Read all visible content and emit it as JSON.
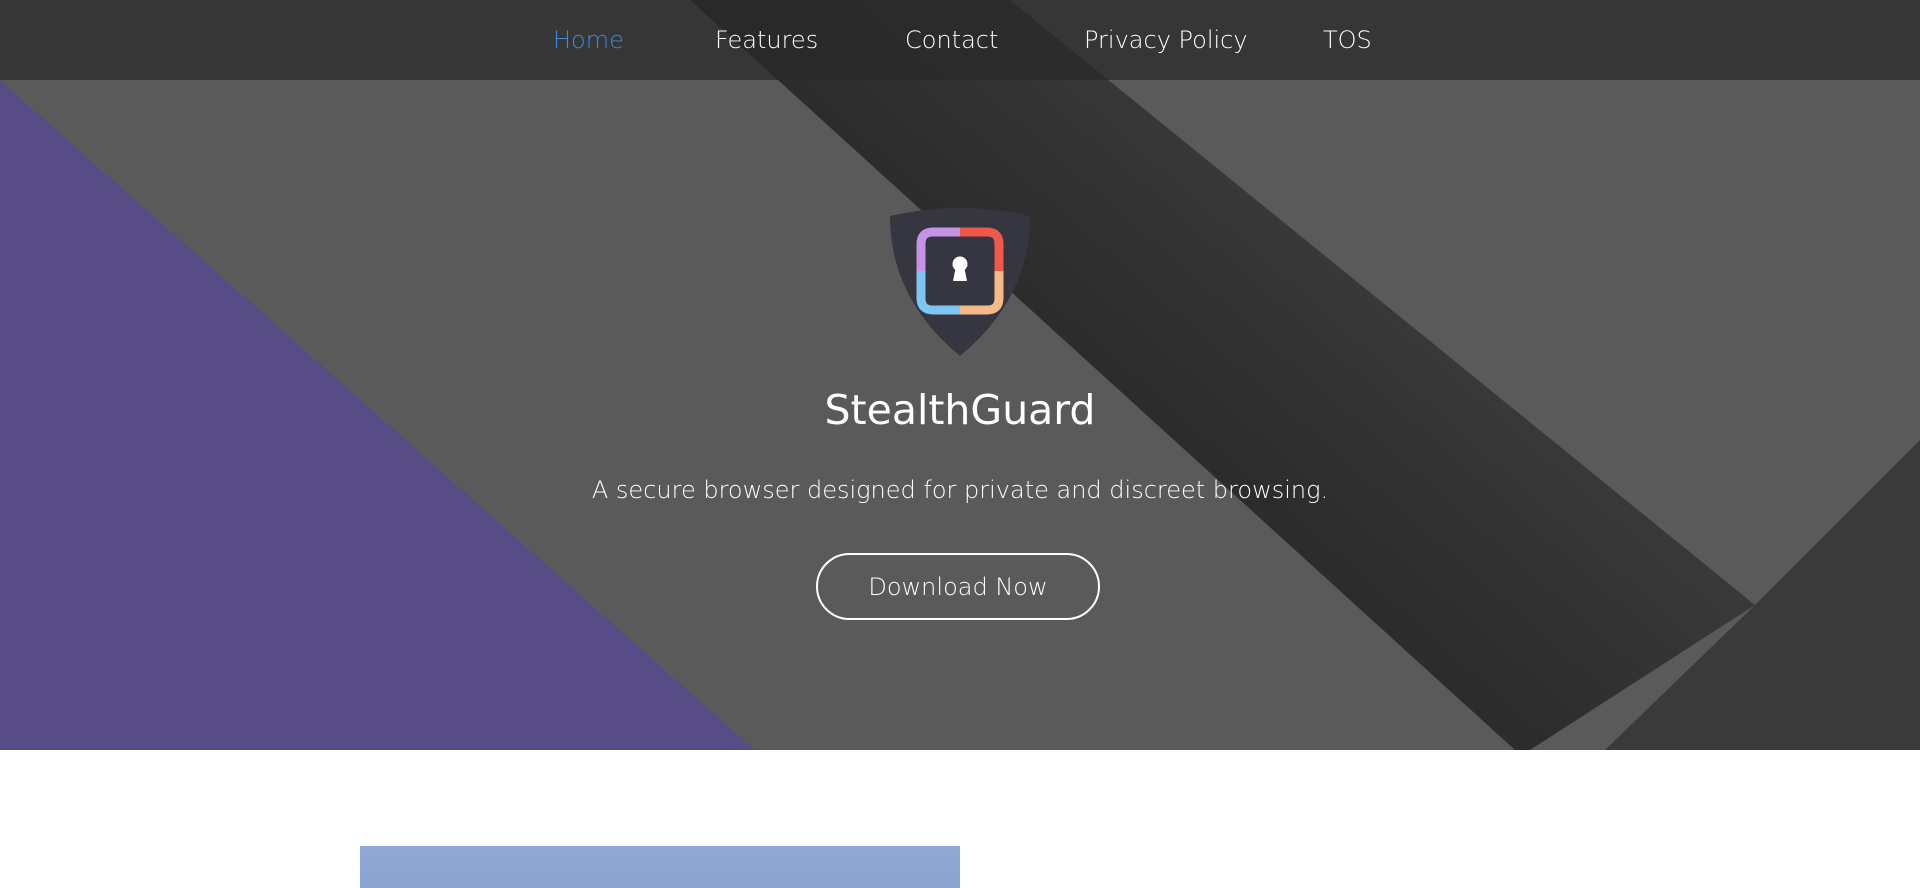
{
  "nav": {
    "items": [
      {
        "label": "Home",
        "active": true
      },
      {
        "label": "Features",
        "active": false
      },
      {
        "label": "Contact",
        "active": false
      },
      {
        "label": "Privacy Policy",
        "active": false
      },
      {
        "label": "TOS",
        "active": false
      }
    ]
  },
  "hero": {
    "logo_icon": "shield-keyhole-icon",
    "title": "StealthGuard",
    "subtitle": "A secure browser designed for private and discreet browsing.",
    "cta_label": "Download Now"
  },
  "colors": {
    "nav_active": "#3c8ad8",
    "hero_gray": "#5a5a5a",
    "hero_purple": "#574c85",
    "text": "#ffffff"
  }
}
